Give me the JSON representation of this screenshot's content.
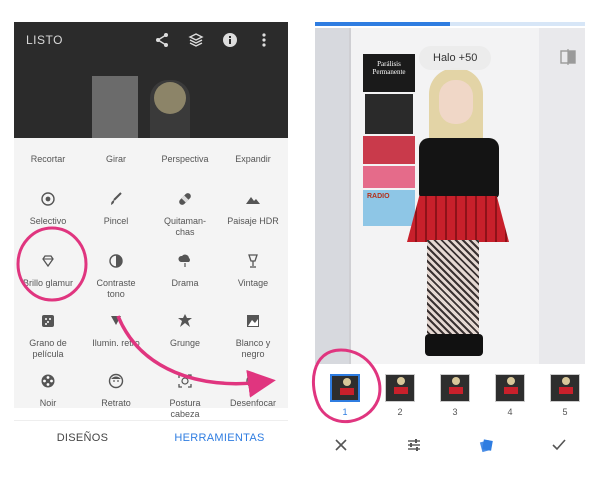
{
  "left_screen": {
    "topbar": {
      "title": "LISTO"
    },
    "tools": [
      {
        "label": "Recortar"
      },
      {
        "label": "Girar"
      },
      {
        "label": "Perspectiva"
      },
      {
        "label": "Expandir"
      },
      {
        "label": "Selectivo"
      },
      {
        "label": "Pincel"
      },
      {
        "label": "Quitaman-\nchas"
      },
      {
        "label": "Paisaje HDR"
      },
      {
        "label": "Brillo glamur"
      },
      {
        "label": "Contraste\ntono"
      },
      {
        "label": "Drama"
      },
      {
        "label": "Vintage"
      },
      {
        "label": "Grano de\npelícula"
      },
      {
        "label": "Ilumin. retro"
      },
      {
        "label": "Grunge"
      },
      {
        "label": "Blanco y\nnegro"
      },
      {
        "label": "Noir"
      },
      {
        "label": "Retrato"
      },
      {
        "label": "Postura\ncabeza"
      },
      {
        "label": "Desenfocar"
      }
    ],
    "tabs": {
      "designs": "DISEÑOS",
      "tools": "HERRAMIENTAS"
    }
  },
  "right_screen": {
    "halo_label": "Halo +50",
    "progress_fraction": 0.5,
    "filmstrip": [
      {
        "num": "1",
        "selected": true
      },
      {
        "num": "2",
        "selected": false
      },
      {
        "num": "3",
        "selected": false
      },
      {
        "num": "4",
        "selected": false
      },
      {
        "num": "5",
        "selected": false
      }
    ],
    "photo_posters": {
      "poster_top_line1": "Parálisis",
      "poster_top_line2": "Permanente",
      "poster_bottom": "RADIO"
    }
  },
  "colors": {
    "accent": "#2f7de1",
    "annotation": "#e0357f",
    "panel_bg": "#f4f4f4",
    "photo_dim": "#2b2b2b"
  }
}
